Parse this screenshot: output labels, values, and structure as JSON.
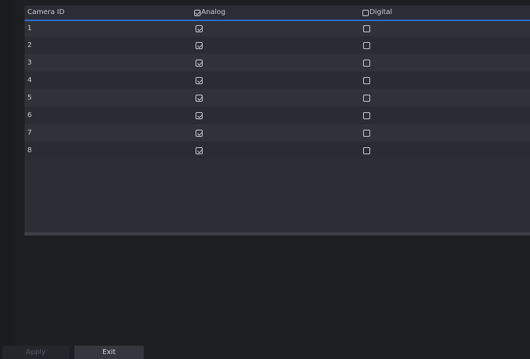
{
  "table": {
    "headers": {
      "camera_id": "Camera ID",
      "analog": "Analog",
      "digital": "Digital"
    },
    "header_analog_checked": true,
    "header_digital_checked": false,
    "rows": [
      {
        "id": "1",
        "analog": true,
        "digital": false
      },
      {
        "id": "2",
        "analog": true,
        "digital": false
      },
      {
        "id": "3",
        "analog": true,
        "digital": false
      },
      {
        "id": "4",
        "analog": true,
        "digital": false
      },
      {
        "id": "5",
        "analog": true,
        "digital": false
      },
      {
        "id": "6",
        "analog": true,
        "digital": false
      },
      {
        "id": "7",
        "analog": true,
        "digital": false
      },
      {
        "id": "8",
        "analog": true,
        "digital": false
      }
    ]
  },
  "buttons": {
    "apply_label": "Apply",
    "exit_label": "Exit"
  },
  "colors": {
    "background": "#1d1e22",
    "table_bg": "#2c2e36",
    "header_underline": "#2f6fd6",
    "checkbox": "#d5d8de"
  }
}
